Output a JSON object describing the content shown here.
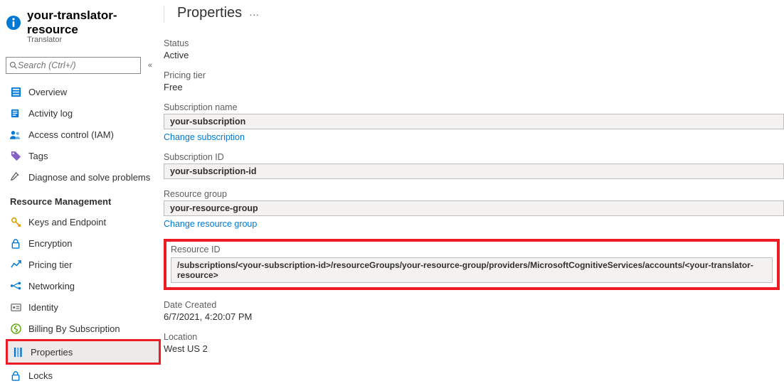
{
  "header": {
    "resource_name": "your-translator-resource",
    "service": "Translator",
    "page_title": "Properties"
  },
  "sidebar": {
    "search_placeholder": "Search (Ctrl+/)",
    "items_top": [
      {
        "label": "Overview",
        "icon": "overview"
      },
      {
        "label": "Activity log",
        "icon": "activity"
      },
      {
        "label": "Access control (IAM)",
        "icon": "iam"
      },
      {
        "label": "Tags",
        "icon": "tags"
      },
      {
        "label": "Diagnose and solve problems",
        "icon": "diagnose"
      }
    ],
    "section": "Resource Management",
    "items_rm": [
      {
        "label": "Keys and Endpoint",
        "icon": "key"
      },
      {
        "label": "Encryption",
        "icon": "lock"
      },
      {
        "label": "Pricing tier",
        "icon": "pricing"
      },
      {
        "label": "Networking",
        "icon": "networking"
      },
      {
        "label": "Identity",
        "icon": "identity"
      },
      {
        "label": "Billing By Subscription",
        "icon": "billing"
      },
      {
        "label": "Properties",
        "icon": "properties"
      },
      {
        "label": "Locks",
        "icon": "locks"
      }
    ]
  },
  "props": {
    "status_label": "Status",
    "status_value": "Active",
    "tier_label": "Pricing tier",
    "tier_value": "Free",
    "sub_name_label": "Subscription name",
    "sub_name_value": "your-subscription",
    "change_sub": "Change subscription",
    "sub_id_label": "Subscription ID",
    "sub_id_value": "your-subscription-id",
    "rg_label": "Resource group",
    "rg_value": "your-resource-group",
    "change_rg": "Change resource group",
    "rid_label": "Resource ID",
    "rid_value": "/subscriptions/<your-subscription-id>/resourceGroups/your-resource-group/providers/MicrosoftCognitiveServices/accounts/<your-translator-resource>",
    "created_label": "Date Created",
    "created_value": "6/7/2021, 4:20:07 PM",
    "location_label": "Location",
    "location_value": "West US 2"
  }
}
